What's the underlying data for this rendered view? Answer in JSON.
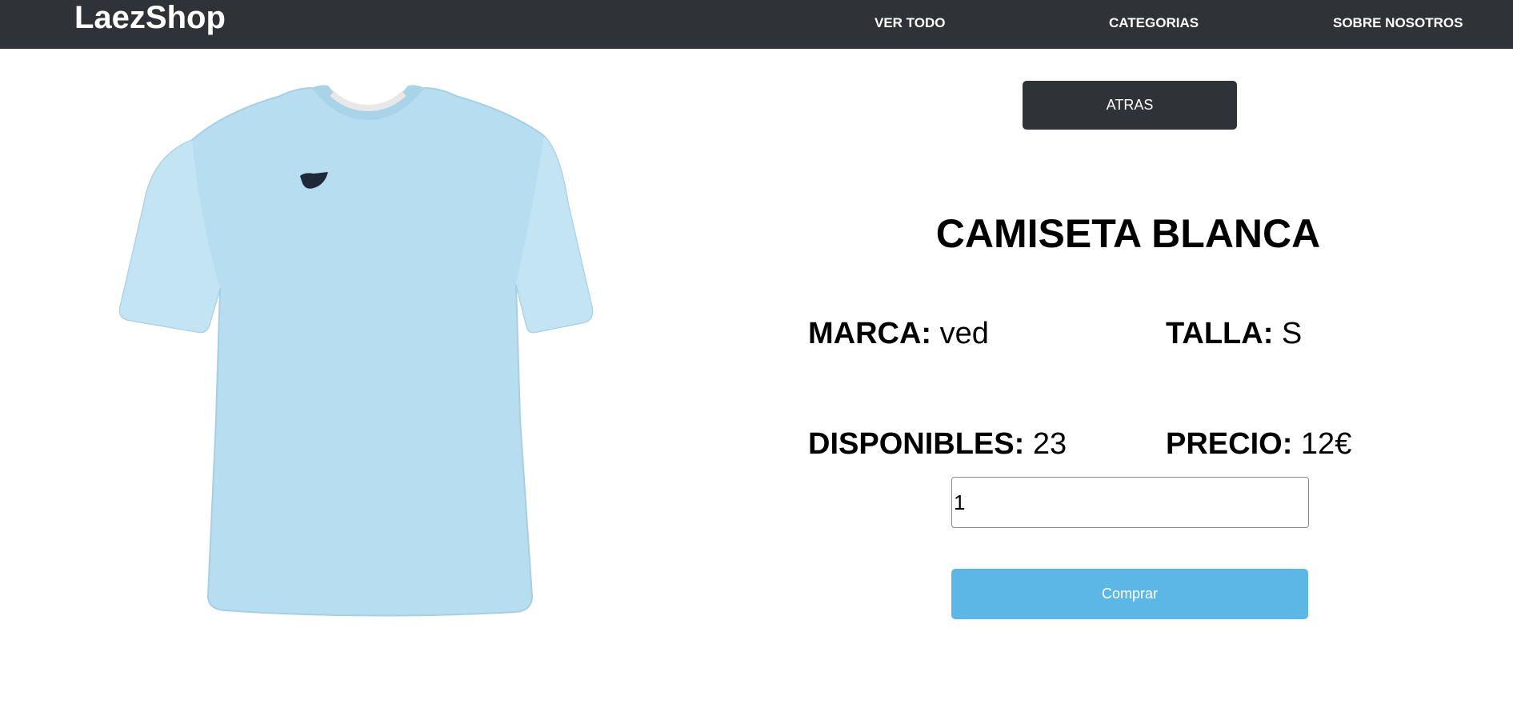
{
  "navbar": {
    "brand": "LaezShop",
    "links": [
      {
        "label": "VER TODO"
      },
      {
        "label": "CATEGORIAS"
      },
      {
        "label": "SOBRE NOSOTROS"
      }
    ],
    "background_color": "#2f3337"
  },
  "product": {
    "image_description_icon": "tshirt-image",
    "back_label": "ATRAS",
    "title": "CAMISETA BLANCA",
    "marca_label": "MARCA:",
    "marca_value": "ved",
    "talla_label": "TALLA:",
    "talla_value": "S",
    "disponibles_label": "DISPONIBLES:",
    "disponibles_value": "23",
    "precio_label": "PRECIO:",
    "precio_value": "12€",
    "quantity_value": "1",
    "buy_label": "Comprar",
    "shirt_color": "#b6def0",
    "buy_color": "#5bb7e5"
  }
}
